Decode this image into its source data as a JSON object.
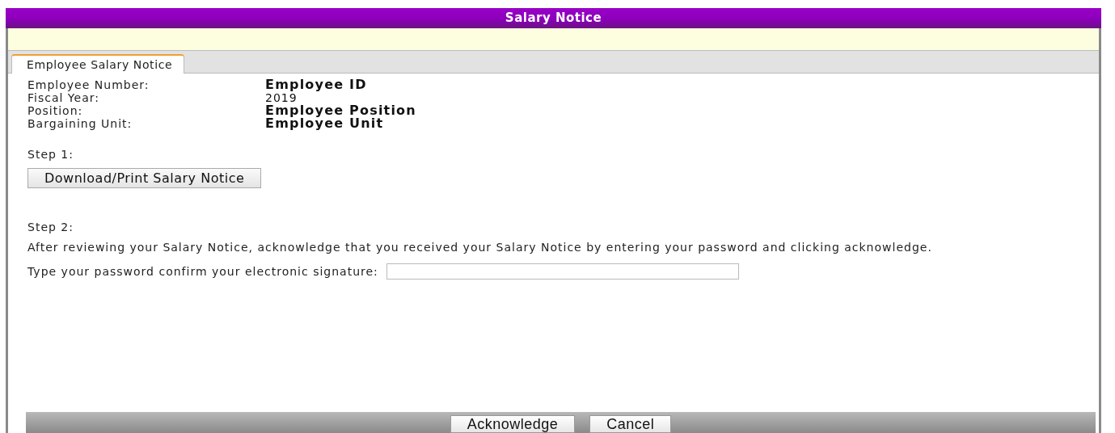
{
  "window": {
    "title": "Salary Notice"
  },
  "tabs": [
    {
      "label": "Employee Salary Notice",
      "selected": true
    }
  ],
  "fields": [
    {
      "label": "Employee Number:",
      "value": "Employee ID",
      "emphasis": true
    },
    {
      "label": "Fiscal Year:",
      "value": "2019",
      "emphasis": false
    },
    {
      "label": "Position:",
      "value": "Employee Position",
      "emphasis": true
    },
    {
      "label": "Bargaining Unit:",
      "value": "Employee Unit",
      "emphasis": true
    }
  ],
  "step1": {
    "heading": "Step 1:",
    "button": "Download/Print Salary Notice"
  },
  "step2": {
    "heading": "Step 2:",
    "instructions": "After reviewing your Salary Notice, acknowledge that you received your Salary Notice by entering your password and clicking acknowledge.",
    "password_label": "Type your password confirm your electronic signature:"
  },
  "buttons": [
    "Acknowledge",
    "Cancel"
  ]
}
